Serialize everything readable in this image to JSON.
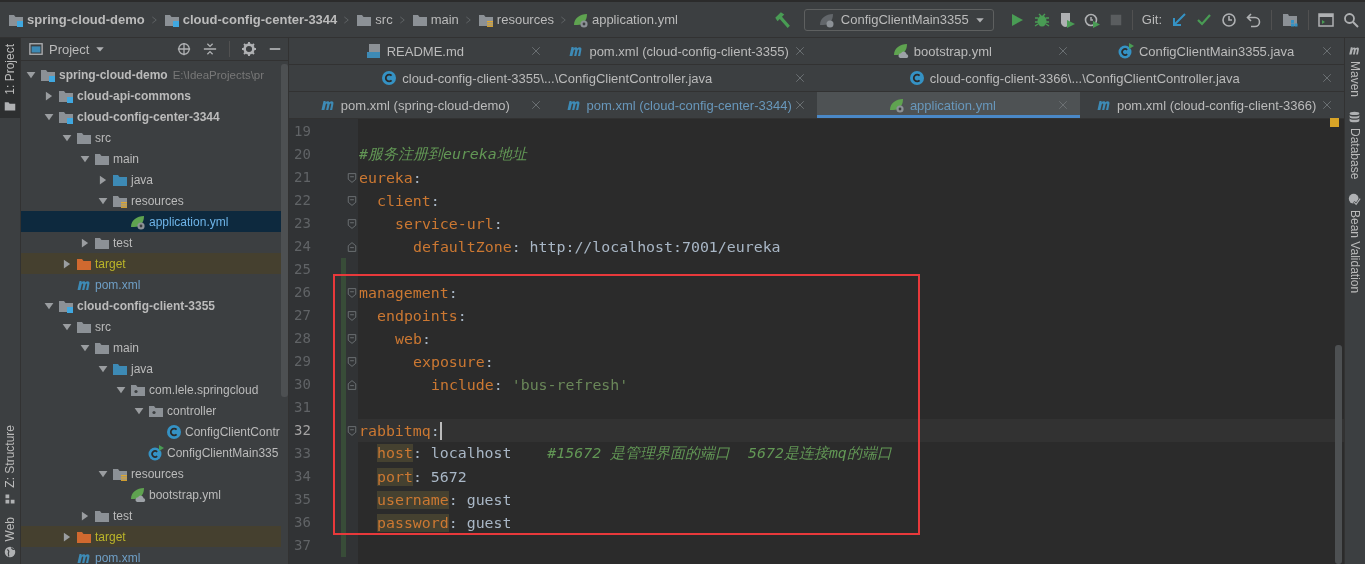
{
  "breadcrumbs": [
    {
      "kind": "module",
      "label": "spring-cloud-demo"
    },
    {
      "kind": "module",
      "label": "cloud-config-center-3344"
    },
    {
      "kind": "folder",
      "label": "src"
    },
    {
      "kind": "folder",
      "label": "main"
    },
    {
      "kind": "resources",
      "label": "resources"
    },
    {
      "kind": "yml",
      "label": "application.yml"
    }
  ],
  "toolbar": {
    "run_config": "ConfigClientMain3355",
    "vcs_label": "Git:"
  },
  "left_stripe": {
    "top": [
      {
        "label": "1: Project",
        "kind": "project",
        "selected": true
      }
    ],
    "bottom": [
      {
        "label": "Z: Structure",
        "kind": "structure",
        "selected": false
      },
      {
        "label": "Web",
        "kind": "web",
        "selected": false
      }
    ]
  },
  "right_stripe": [
    {
      "label": "Maven",
      "kind": "maven"
    },
    {
      "label": "Database",
      "kind": "database"
    },
    {
      "label": "Bean Validation",
      "kind": "bean"
    }
  ],
  "project_panel": {
    "title": "Project",
    "tree": [
      {
        "label": "spring-cloud-demo",
        "path": "E:\\IdeaProjects\\pr",
        "kind": "module",
        "expanded": true,
        "selected": false,
        "children": [
          {
            "label": "cloud-api-commons",
            "kind": "module",
            "expanded": false,
            "selected": false
          },
          {
            "label": "cloud-config-center-3344",
            "kind": "module",
            "expanded": true,
            "selected": false,
            "children": [
              {
                "label": "src",
                "kind": "folder",
                "expanded": true,
                "selected": false,
                "children": [
                  {
                    "label": "main",
                    "kind": "folder",
                    "expanded": true,
                    "selected": false,
                    "children": [
                      {
                        "label": "java",
                        "kind": "source",
                        "expanded": false,
                        "selected": false
                      },
                      {
                        "label": "resources",
                        "kind": "resources",
                        "expanded": true,
                        "selected": false,
                        "children": [
                          {
                            "label": "application.yml",
                            "kind": "yml",
                            "selected": true
                          }
                        ]
                      }
                    ]
                  },
                  {
                    "label": "test",
                    "kind": "folder",
                    "expanded": false,
                    "selected": false
                  }
                ]
              },
              {
                "label": "target",
                "kind": "excluded",
                "expanded": false,
                "selected": false
              },
              {
                "label": "pom.xml",
                "kind": "pom",
                "selected": false
              }
            ]
          },
          {
            "label": "cloud-config-client-3355",
            "kind": "module",
            "expanded": true,
            "selected": false,
            "children": [
              {
                "label": "src",
                "kind": "folder",
                "expanded": true,
                "selected": false,
                "children": [
                  {
                    "label": "main",
                    "kind": "folder",
                    "expanded": true,
                    "selected": false,
                    "children": [
                      {
                        "label": "java",
                        "kind": "source",
                        "expanded": true,
                        "selected": false,
                        "children": [
                          {
                            "label": "com.lele.springcloud",
                            "kind": "package",
                            "expanded": true,
                            "selected": false,
                            "children": [
                              {
                                "label": "controller",
                                "kind": "package",
                                "expanded": true,
                                "selected": false,
                                "children": [
                                  {
                                    "label": "ConfigClientContr",
                                    "kind": "class",
                                    "selected": false
                                  }
                                ]
                              },
                              {
                                "label": "ConfigClientMain335",
                                "kind": "main-class",
                                "selected": false
                              }
                            ]
                          }
                        ]
                      },
                      {
                        "label": "resources",
                        "kind": "resources",
                        "expanded": true,
                        "selected": false,
                        "children": [
                          {
                            "label": "bootstrap.yml",
                            "kind": "yml-boot",
                            "selected": false
                          }
                        ]
                      }
                    ]
                  },
                  {
                    "label": "test",
                    "kind": "folder",
                    "expanded": false,
                    "selected": false
                  }
                ]
              },
              {
                "label": "target",
                "kind": "excluded",
                "expanded": false,
                "selected": false
              },
              {
                "label": "pom.xml",
                "kind": "pom",
                "selected": false
              }
            ]
          }
        ]
      }
    ]
  },
  "editor": {
    "tab_rows": [
      [
        {
          "label": "README.md",
          "kind": "md",
          "selected": false,
          "modified": false
        },
        {
          "label": "pom.xml (cloud-config-client-3355)",
          "kind": "pom",
          "selected": false,
          "modified": false
        },
        {
          "label": "bootstrap.yml",
          "kind": "yml-boot",
          "selected": false,
          "modified": false
        },
        {
          "label": "ConfigClientMain3355.java",
          "kind": "main-class",
          "selected": false,
          "modified": false
        }
      ],
      [
        {
          "label": "cloud-config-client-3355\\...\\ConfigClientController.java",
          "kind": "class",
          "selected": false,
          "modified": false
        },
        {
          "label": "cloud-config-client-3366\\...\\ConfigClientController.java",
          "kind": "class",
          "selected": false,
          "modified": false
        }
      ],
      [
        {
          "label": "pom.xml (spring-cloud-demo)",
          "kind": "pom",
          "selected": false,
          "modified": false
        },
        {
          "label": "pom.xml (cloud-config-center-3344)",
          "kind": "pom",
          "selected": false,
          "modified": true
        },
        {
          "label": "application.yml",
          "kind": "yml",
          "selected": true,
          "modified": true
        },
        {
          "label": "pom.xml (cloud-config-client-3366)",
          "kind": "pom",
          "selected": false,
          "modified": false
        }
      ]
    ],
    "lines": [
      {
        "number": "19",
        "kind": "plain",
        "changed": false,
        "caret": false,
        "framed": false
      },
      {
        "number": "20",
        "kind": "plain",
        "changed": false,
        "caret": false,
        "framed": false,
        "tokens": [
          {
            "kind": "comment",
            "text": "#服务注册到eureka地址"
          }
        ]
      },
      {
        "number": "21",
        "kind": "fold-start",
        "changed": false,
        "caret": false,
        "framed": false,
        "tokens": [
          {
            "kind": "key",
            "text": "eureka"
          },
          {
            "kind": "punct",
            "text": ":"
          }
        ],
        "children": [
          {
            "number": "22",
            "kind": "fold-start",
            "changed": false,
            "caret": false,
            "framed": false,
            "tokens": [
              {
                "kind": "key",
                "text": "client"
              },
              {
                "kind": "punct",
                "text": ":"
              }
            ],
            "children": [
              {
                "number": "23",
                "kind": "fold-start",
                "changed": false,
                "caret": false,
                "framed": false,
                "tokens": [
                  {
                    "kind": "key",
                    "text": "service-url"
                  },
                  {
                    "kind": "punct",
                    "text": ":"
                  }
                ],
                "children": [
                  {
                    "number": "24",
                    "kind": "fold-end",
                    "changed": false,
                    "caret": false,
                    "framed": false,
                    "tokens": [
                      {
                        "kind": "key",
                        "text": "defaultZone"
                      },
                      {
                        "kind": "punct",
                        "text": ": "
                      },
                      {
                        "kind": "value",
                        "text": "http://localhost:7001/eureka"
                      }
                    ]
                  }
                ]
              }
            ]
          }
        ]
      },
      {
        "number": "25",
        "kind": "plain",
        "changed": true,
        "caret": false,
        "framed": false
      },
      {
        "number": "26",
        "kind": "fold-start",
        "changed": true,
        "caret": false,
        "framed": true,
        "tokens": [
          {
            "kind": "key",
            "text": "management"
          },
          {
            "kind": "punct",
            "text": ":"
          }
        ],
        "children": [
          {
            "number": "27",
            "kind": "fold-start",
            "changed": true,
            "caret": false,
            "framed": true,
            "tokens": [
              {
                "kind": "key",
                "text": "endpoints"
              },
              {
                "kind": "punct",
                "text": ":"
              }
            ],
            "children": [
              {
                "number": "28",
                "kind": "fold-start",
                "changed": true,
                "caret": false,
                "framed": true,
                "tokens": [
                  {
                    "kind": "key",
                    "text": "web"
                  },
                  {
                    "kind": "punct",
                    "text": ":"
                  }
                ],
                "children": [
                  {
                    "number": "29",
                    "kind": "fold-start",
                    "changed": true,
                    "caret": false,
                    "framed": true,
                    "tokens": [
                      {
                        "kind": "key",
                        "text": "exposure"
                      },
                      {
                        "kind": "punct",
                        "text": ":"
                      }
                    ],
                    "children": [
                      {
                        "number": "30",
                        "kind": "fold-end",
                        "changed": true,
                        "caret": false,
                        "framed": true,
                        "tokens": [
                          {
                            "kind": "key",
                            "text": "include"
                          },
                          {
                            "kind": "punct",
                            "text": ": "
                          },
                          {
                            "kind": "string",
                            "text": "'bus-refresh'"
                          }
                        ]
                      }
                    ]
                  }
                ]
              }
            ]
          }
        ]
      },
      {
        "number": "31",
        "kind": "plain",
        "changed": true,
        "caret": false,
        "framed": true
      },
      {
        "number": "32",
        "kind": "fold-start",
        "changed": true,
        "caret": true,
        "framed": true,
        "tokens": [
          {
            "kind": "key",
            "text": "rabbitmq"
          },
          {
            "kind": "punct",
            "text": ":"
          }
        ],
        "children": [
          {
            "number": "33",
            "kind": "plain",
            "changed": true,
            "caret": false,
            "framed": true,
            "tokens": [
              {
                "kind": "key-marked",
                "text": "host"
              },
              {
                "kind": "punct",
                "text": ": "
              },
              {
                "kind": "value",
                "text": "localhost"
              },
              {
                "kind": "comment",
                "text": "#15672 是管理界面的端口  5672是连接mq的端口"
              }
            ]
          },
          {
            "number": "34",
            "kind": "plain",
            "changed": true,
            "caret": false,
            "framed": true,
            "tokens": [
              {
                "kind": "key-marked",
                "text": "port"
              },
              {
                "kind": "punct",
                "text": ": "
              },
              {
                "kind": "value",
                "text": "5672"
              }
            ]
          },
          {
            "number": "35",
            "kind": "plain",
            "changed": true,
            "caret": false,
            "framed": true,
            "tokens": [
              {
                "kind": "key-marked",
                "text": "username"
              },
              {
                "kind": "punct",
                "text": ": "
              },
              {
                "kind": "value",
                "text": "guest"
              }
            ]
          },
          {
            "number": "36",
            "kind": "plain",
            "changed": true,
            "caret": false,
            "framed": true,
            "tokens": [
              {
                "kind": "key-marked",
                "text": "password"
              },
              {
                "kind": "punct",
                "text": ": "
              },
              {
                "kind": "value",
                "text": "guest"
              }
            ]
          }
        ]
      },
      {
        "number": "37",
        "kind": "plain",
        "changed": true,
        "caret": false,
        "framed": false
      }
    ]
  }
}
